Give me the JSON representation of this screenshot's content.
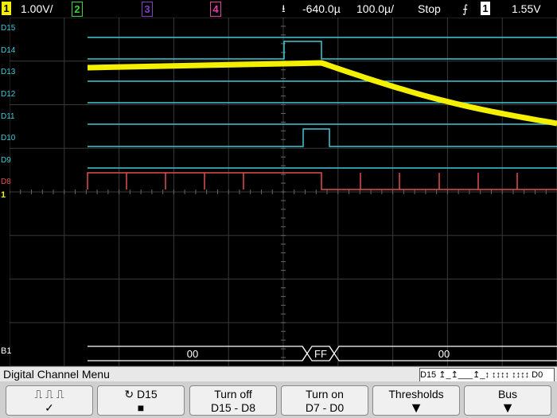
{
  "topbar": {
    "ch1_num": "1",
    "ch1_scale": "1.00V/",
    "ch2_num": "2",
    "ch3_num": "3",
    "ch4_num": "4",
    "time_delay": "-640.0µ",
    "time_scale": "100.0µ/",
    "run_state": "Stop",
    "trigger_source": "1",
    "trigger_level": "1.55V"
  },
  "channels": {
    "labels": [
      "D15",
      "D14",
      "D13",
      "D12",
      "D11",
      "D10",
      "D9",
      "D8"
    ],
    "analog_marker": "1",
    "bus_label": "B1",
    "bus_values": [
      "00",
      "FF",
      "00"
    ]
  },
  "colors": {
    "analog": "#f5f000",
    "digital": "#40c8d8",
    "d8": "#e05050",
    "grid": "#3a3a3a",
    "ch2": "#40d040",
    "ch3": "#8040c0",
    "ch4": "#e040a0"
  },
  "menu": {
    "title": "Digital Channel Menu",
    "indicator": "D15 ↥_↥___↥_↕ ↕↕↕↕ ↕↕↕↕ D0"
  },
  "softkeys": [
    {
      "line1": "⎍ ⎍ ⎍",
      "line2": "✓"
    },
    {
      "line1": "↻  D15",
      "line2": "■"
    },
    {
      "line1": "Turn off",
      "line2": "D15 - D8"
    },
    {
      "line1": "Turn on",
      "line2": "D7 - D0"
    },
    {
      "line1": "Thresholds",
      "line2": "▼"
    },
    {
      "line1": "Bus",
      "line2": "▼"
    }
  ]
}
